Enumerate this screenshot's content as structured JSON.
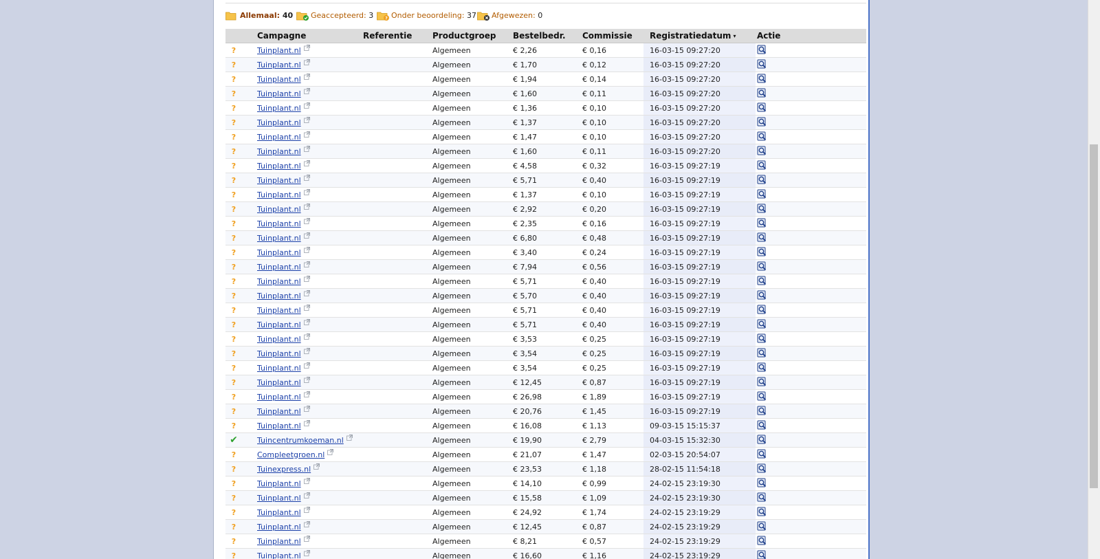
{
  "tabs": [
    {
      "name": "Allemaal:",
      "count": "40",
      "active": true,
      "badge": "none"
    },
    {
      "name": "Geaccepteerd:",
      "count": "3",
      "active": false,
      "badge": "check"
    },
    {
      "name": "Onder beoordeling:",
      "count": "37",
      "active": false,
      "badge": "question"
    },
    {
      "name": "Afgewezen:",
      "count": "0",
      "active": false,
      "badge": "cross"
    }
  ],
  "table": {
    "headers": {
      "campagne": "Campagne",
      "referentie": "Referentie",
      "productgroep": "Productgroep",
      "bestelbedr": "Bestelbedr.",
      "commissie": "Commissie",
      "registratiedatum": "Registratiedatum",
      "actie": "Actie"
    },
    "sort_indicator": "▾",
    "rows": [
      {
        "status": "?",
        "campaign": "Tuinplant.nl",
        "productgroup": "Algemeen",
        "amount": "€ 2,26",
        "commission": "€ 0,16",
        "date": "16-03-15 09:27:20"
      },
      {
        "status": "?",
        "campaign": "Tuinplant.nl",
        "productgroup": "Algemeen",
        "amount": "€ 1,70",
        "commission": "€ 0,12",
        "date": "16-03-15 09:27:20"
      },
      {
        "status": "?",
        "campaign": "Tuinplant.nl",
        "productgroup": "Algemeen",
        "amount": "€ 1,94",
        "commission": "€ 0,14",
        "date": "16-03-15 09:27:20"
      },
      {
        "status": "?",
        "campaign": "Tuinplant.nl",
        "productgroup": "Algemeen",
        "amount": "€ 1,60",
        "commission": "€ 0,11",
        "date": "16-03-15 09:27:20"
      },
      {
        "status": "?",
        "campaign": "Tuinplant.nl",
        "productgroup": "Algemeen",
        "amount": "€ 1,36",
        "commission": "€ 0,10",
        "date": "16-03-15 09:27:20"
      },
      {
        "status": "?",
        "campaign": "Tuinplant.nl",
        "productgroup": "Algemeen",
        "amount": "€ 1,37",
        "commission": "€ 0,10",
        "date": "16-03-15 09:27:20"
      },
      {
        "status": "?",
        "campaign": "Tuinplant.nl",
        "productgroup": "Algemeen",
        "amount": "€ 1,47",
        "commission": "€ 0,10",
        "date": "16-03-15 09:27:20"
      },
      {
        "status": "?",
        "campaign": "Tuinplant.nl",
        "productgroup": "Algemeen",
        "amount": "€ 1,60",
        "commission": "€ 0,11",
        "date": "16-03-15 09:27:20"
      },
      {
        "status": "?",
        "campaign": "Tuinplant.nl",
        "productgroup": "Algemeen",
        "amount": "€ 4,58",
        "commission": "€ 0,32",
        "date": "16-03-15 09:27:19"
      },
      {
        "status": "?",
        "campaign": "Tuinplant.nl",
        "productgroup": "Algemeen",
        "amount": "€ 5,71",
        "commission": "€ 0,40",
        "date": "16-03-15 09:27:19"
      },
      {
        "status": "?",
        "campaign": "Tuinplant.nl",
        "productgroup": "Algemeen",
        "amount": "€ 1,37",
        "commission": "€ 0,10",
        "date": "16-03-15 09:27:19"
      },
      {
        "status": "?",
        "campaign": "Tuinplant.nl",
        "productgroup": "Algemeen",
        "amount": "€ 2,92",
        "commission": "€ 0,20",
        "date": "16-03-15 09:27:19"
      },
      {
        "status": "?",
        "campaign": "Tuinplant.nl",
        "productgroup": "Algemeen",
        "amount": "€ 2,35",
        "commission": "€ 0,16",
        "date": "16-03-15 09:27:19"
      },
      {
        "status": "?",
        "campaign": "Tuinplant.nl",
        "productgroup": "Algemeen",
        "amount": "€ 6,80",
        "commission": "€ 0,48",
        "date": "16-03-15 09:27:19"
      },
      {
        "status": "?",
        "campaign": "Tuinplant.nl",
        "productgroup": "Algemeen",
        "amount": "€ 3,40",
        "commission": "€ 0,24",
        "date": "16-03-15 09:27:19"
      },
      {
        "status": "?",
        "campaign": "Tuinplant.nl",
        "productgroup": "Algemeen",
        "amount": "€ 7,94",
        "commission": "€ 0,56",
        "date": "16-03-15 09:27:19"
      },
      {
        "status": "?",
        "campaign": "Tuinplant.nl",
        "productgroup": "Algemeen",
        "amount": "€ 5,71",
        "commission": "€ 0,40",
        "date": "16-03-15 09:27:19"
      },
      {
        "status": "?",
        "campaign": "Tuinplant.nl",
        "productgroup": "Algemeen",
        "amount": "€ 5,70",
        "commission": "€ 0,40",
        "date": "16-03-15 09:27:19"
      },
      {
        "status": "?",
        "campaign": "Tuinplant.nl",
        "productgroup": "Algemeen",
        "amount": "€ 5,71",
        "commission": "€ 0,40",
        "date": "16-03-15 09:27:19"
      },
      {
        "status": "?",
        "campaign": "Tuinplant.nl",
        "productgroup": "Algemeen",
        "amount": "€ 5,71",
        "commission": "€ 0,40",
        "date": "16-03-15 09:27:19"
      },
      {
        "status": "?",
        "campaign": "Tuinplant.nl",
        "productgroup": "Algemeen",
        "amount": "€ 3,53",
        "commission": "€ 0,25",
        "date": "16-03-15 09:27:19"
      },
      {
        "status": "?",
        "campaign": "Tuinplant.nl",
        "productgroup": "Algemeen",
        "amount": "€ 3,54",
        "commission": "€ 0,25",
        "date": "16-03-15 09:27:19"
      },
      {
        "status": "?",
        "campaign": "Tuinplant.nl",
        "productgroup": "Algemeen",
        "amount": "€ 3,54",
        "commission": "€ 0,25",
        "date": "16-03-15 09:27:19"
      },
      {
        "status": "?",
        "campaign": "Tuinplant.nl",
        "productgroup": "Algemeen",
        "amount": "€ 12,45",
        "commission": "€ 0,87",
        "date": "16-03-15 09:27:19"
      },
      {
        "status": "?",
        "campaign": "Tuinplant.nl",
        "productgroup": "Algemeen",
        "amount": "€ 26,98",
        "commission": "€ 1,89",
        "date": "16-03-15 09:27:19"
      },
      {
        "status": "?",
        "campaign": "Tuinplant.nl",
        "productgroup": "Algemeen",
        "amount": "€ 20,76",
        "commission": "€ 1,45",
        "date": "16-03-15 09:27:19"
      },
      {
        "status": "?",
        "campaign": "Tuinplant.nl",
        "productgroup": "Algemeen",
        "amount": "€ 16,08",
        "commission": "€ 1,13",
        "date": "09-03-15 15:15:37"
      },
      {
        "status": "ok",
        "campaign": "Tuincentrumkoeman.nl",
        "productgroup": "Algemeen",
        "amount": "€ 19,90",
        "commission": "€ 2,79",
        "date": "04-03-15 15:32:30"
      },
      {
        "status": "?",
        "campaign": "Compleetgroen.nl",
        "productgroup": "Algemeen",
        "amount": "€ 21,07",
        "commission": "€ 1,47",
        "date": "02-03-15 20:54:07"
      },
      {
        "status": "?",
        "campaign": "Tuinexpress.nl",
        "productgroup": "Algemeen",
        "amount": "€ 23,53",
        "commission": "€ 1,18",
        "date": "28-02-15 11:54:18"
      },
      {
        "status": "?",
        "campaign": "Tuinplant.nl",
        "productgroup": "Algemeen",
        "amount": "€ 14,10",
        "commission": "€ 0,99",
        "date": "24-02-15 23:19:30"
      },
      {
        "status": "?",
        "campaign": "Tuinplant.nl",
        "productgroup": "Algemeen",
        "amount": "€ 15,58",
        "commission": "€ 1,09",
        "date": "24-02-15 23:19:30"
      },
      {
        "status": "?",
        "campaign": "Tuinplant.nl",
        "productgroup": "Algemeen",
        "amount": "€ 24,92",
        "commission": "€ 1,74",
        "date": "24-02-15 23:19:29"
      },
      {
        "status": "?",
        "campaign": "Tuinplant.nl",
        "productgroup": "Algemeen",
        "amount": "€ 12,45",
        "commission": "€ 0,87",
        "date": "24-02-15 23:19:29"
      },
      {
        "status": "?",
        "campaign": "Tuinplant.nl",
        "productgroup": "Algemeen",
        "amount": "€ 8,21",
        "commission": "€ 0,57",
        "date": "24-02-15 23:19:29"
      },
      {
        "status": "?",
        "campaign": "Tuinplant.nl",
        "productgroup": "Algemeen",
        "amount": "€ 16,60",
        "commission": "€ 1,16",
        "date": "24-02-15 23:19:29"
      }
    ]
  },
  "colors": {
    "question": "#f0a020",
    "check": "#2ea12e",
    "link": "#1a3fa8",
    "header_bg": "#dcdcdc",
    "active_tab": "#8b3a00"
  },
  "icons": {
    "folder": "folder-icon",
    "external": "external-link-icon",
    "action": "view-details-icon"
  }
}
